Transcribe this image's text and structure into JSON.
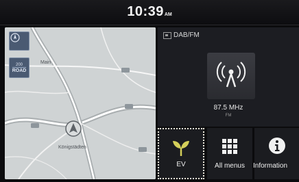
{
  "status_bar": {
    "time": "10:39",
    "ampm": "AM"
  },
  "map": {
    "scale_top": "200",
    "scale_bottom": "ROAD",
    "labels": [
      "Main",
      "Königstädten"
    ]
  },
  "radio": {
    "source": "DAB/FM",
    "frequency": "87.5 MHz",
    "band": "FM"
  },
  "menu_tiles": [
    {
      "label": "EV",
      "icon": "leaf-sprout-icon",
      "selected": true
    },
    {
      "label": "All menus",
      "icon": "grid-icon"
    },
    {
      "label": "Information",
      "icon": "info-icon"
    }
  ],
  "colors": {
    "background": "#0b0b0d",
    "panel": "#1c1d22",
    "ev_accent": "#d4cf5a"
  }
}
